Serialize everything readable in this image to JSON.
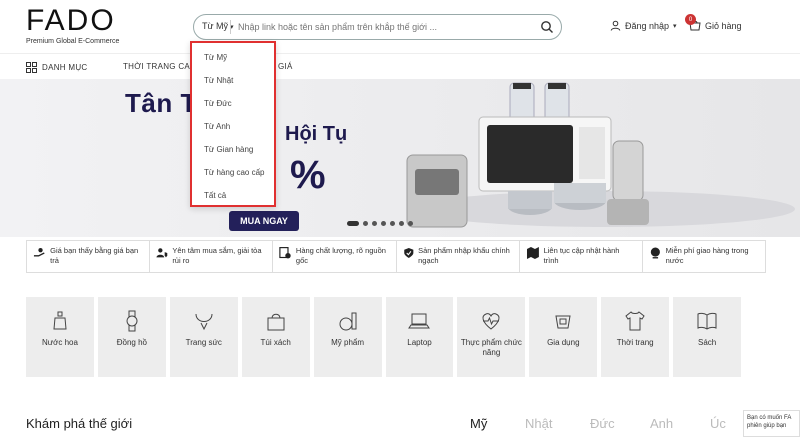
{
  "header": {
    "logo": "FADO",
    "tagline": "Premium Global E-Commerce",
    "search": {
      "selected": "Từ Mỹ",
      "placeholder": "Nhập link hoặc tên sản phẩm trên khắp thế giới ..."
    },
    "login_label": "Đăng nhập",
    "cart_label": "Giỏ hàng",
    "cart_count": "0"
  },
  "dropdown": {
    "items": [
      "Từ Mỹ",
      "Từ Nhật",
      "Từ Đức",
      "Từ Anh",
      "Từ Gian hàng",
      "Từ hàng cao cấp",
      "Tất cả"
    ]
  },
  "nav": {
    "categories_label": "DANH MỤC",
    "item1": "THỜI TRANG CAO C",
    "item2": "GIÁ"
  },
  "banner": {
    "title": "Tân  Tổ Ấm",
    "subtitle": "Hội Tụ",
    "percent": "%",
    "cta": "MUA NGAY"
  },
  "features": [
    {
      "icon": "hand-money-icon",
      "text": "Giá bạn thấy bằng giá bạn trả"
    },
    {
      "icon": "shield-user-icon",
      "text": "Yên tâm mua sắm, giải tỏa rủi ro"
    },
    {
      "icon": "quality-check-icon",
      "text": "Hàng chất lượng, rõ nguồn gốc"
    },
    {
      "icon": "shield-check-icon",
      "text": "Sản phẩm nhập khẩu chính ngạch"
    },
    {
      "icon": "map-icon",
      "text": "Liên tục cập nhật hành trình"
    },
    {
      "icon": "globe-icon",
      "text": "Miễn phí giao hàng trong nước"
    }
  ],
  "categories": [
    {
      "label": "Nước hoa",
      "icon": "perfume-icon"
    },
    {
      "label": "Đồng hồ",
      "icon": "watch-icon"
    },
    {
      "label": "Trang sức",
      "icon": "necklace-icon"
    },
    {
      "label": "Túi xách",
      "icon": "handbag-icon"
    },
    {
      "label": "Mỹ phẩm",
      "icon": "cosmetics-icon"
    },
    {
      "label": "Laptop",
      "icon": "laptop-icon"
    },
    {
      "label": "Thực phẩm chức năng",
      "icon": "heartbeat-icon"
    },
    {
      "label": "Gia dụng",
      "icon": "household-icon"
    },
    {
      "label": "Thời trang",
      "icon": "shirt-icon"
    },
    {
      "label": "Sách",
      "icon": "book-icon"
    }
  ],
  "explore": {
    "title": "Khám phá thế giới",
    "tabs": [
      "Mỹ",
      "Nhật",
      "Đức",
      "Anh",
      "Úc"
    ]
  },
  "chat_hint": "Bạn có muốn FA phiên giúp bạn"
}
